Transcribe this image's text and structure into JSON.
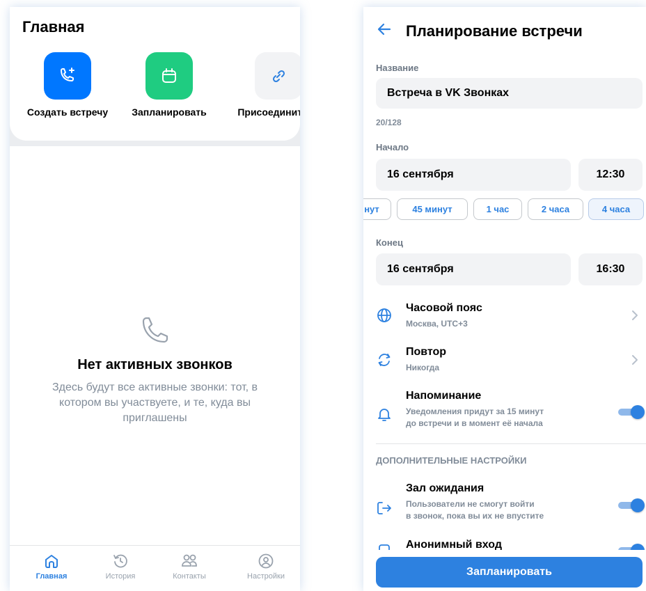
{
  "home": {
    "title": "Главная",
    "actions": [
      {
        "label": "Создать встречу",
        "icon": "phone-plus-icon",
        "color": "#0077ff"
      },
      {
        "label": "Запланировать",
        "icon": "calendar-icon",
        "color": "#1fcc81"
      },
      {
        "label": "Присоединиться",
        "icon": "link-icon",
        "color": "#f2f3f5"
      }
    ],
    "empty": {
      "icon": "phone-icon",
      "title": "Нет активных звонков",
      "text": "Здесь будут все активные звонки: тот, в котором вы участвуете, и те, куда вы приглашены"
    },
    "tabs": [
      {
        "label": "Главная",
        "icon": "home-icon",
        "active": true
      },
      {
        "label": "История",
        "icon": "history-icon",
        "active": false
      },
      {
        "label": "Контакты",
        "icon": "contacts-icon",
        "active": false
      },
      {
        "label": "Настройки",
        "icon": "settings-icon",
        "active": false
      }
    ]
  },
  "schedule": {
    "title": "Планирование встречи",
    "name_label": "Название",
    "name_value": "Встреча в VK Звонках",
    "name_counter": "20/128",
    "start_label": "Начало",
    "start_date": "16 сентября",
    "start_time": "12:30",
    "durations": [
      "нут",
      "45 минут",
      "1 час",
      "2 часа",
      "4 часа"
    ],
    "selected_duration": "4 часа",
    "end_label": "Конец",
    "end_date": "16 сентября",
    "end_time": "16:30",
    "timezone": {
      "title": "Часовой пояс",
      "value": "Москва, UTC+3",
      "icon": "globe-icon"
    },
    "repeat": {
      "title": "Повтор",
      "value": "Никогда",
      "icon": "repeat-icon"
    },
    "reminder": {
      "title": "Напоминание",
      "line1": "Уведомления придут за 15 минут",
      "line2": "до встречи и в момент её начала",
      "icon": "bell-icon",
      "enabled": true
    },
    "extra_label": "ДОПОЛНИТЕЛЬНЫЕ НАСТРОЙКИ",
    "waiting_room": {
      "title": "Зал ожидания",
      "line1": "Пользователи не смогут войти",
      "line2": "в звонок, пока вы их не впустите",
      "icon": "enter-icon",
      "enabled": true
    },
    "anonymous": {
      "title": "Анонимный вход",
      "enabled": true
    },
    "submit_label": "Запланировать"
  },
  "colors": {
    "accent": "#2d81e0",
    "primary_button": "#2d81e0",
    "green": "#1fcc81",
    "blue": "#0077ff"
  }
}
